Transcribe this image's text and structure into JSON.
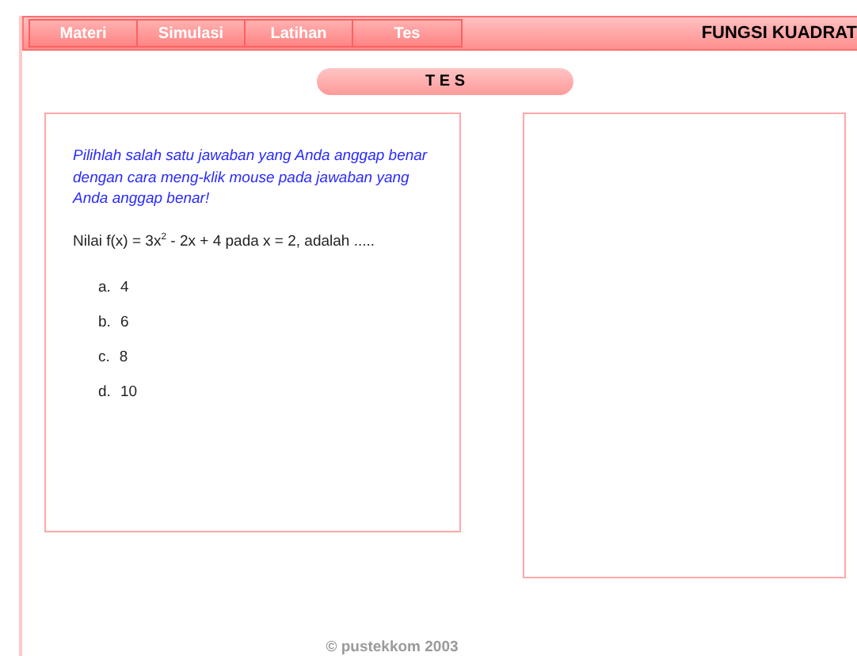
{
  "nav": {
    "tabs": [
      {
        "label": "Materi",
        "selected": false
      },
      {
        "label": "Simulasi",
        "selected": false
      },
      {
        "label": "Latihan",
        "selected": false
      },
      {
        "label": "Tes",
        "selected": false
      }
    ],
    "title": "FUNGSI KUADRAT"
  },
  "section_title": "T E S",
  "question_card": {
    "instruction": "Pilihlah salah satu jawaban yang Anda anggap benar dengan cara meng-klik mouse pada jawaban yang Anda anggap benar!",
    "question": "Nilai f(x) = 3x$^{2}$ - 2x + 4  pada x = 2, adalah .....",
    "options": [
      {
        "letter": "a.",
        "text": "4"
      },
      {
        "letter": "b.",
        "text": "6"
      },
      {
        "letter": "c.",
        "text": "8"
      },
      {
        "letter": "d.",
        "text": "10"
      }
    ]
  },
  "footer": "© pustekkom 2003"
}
